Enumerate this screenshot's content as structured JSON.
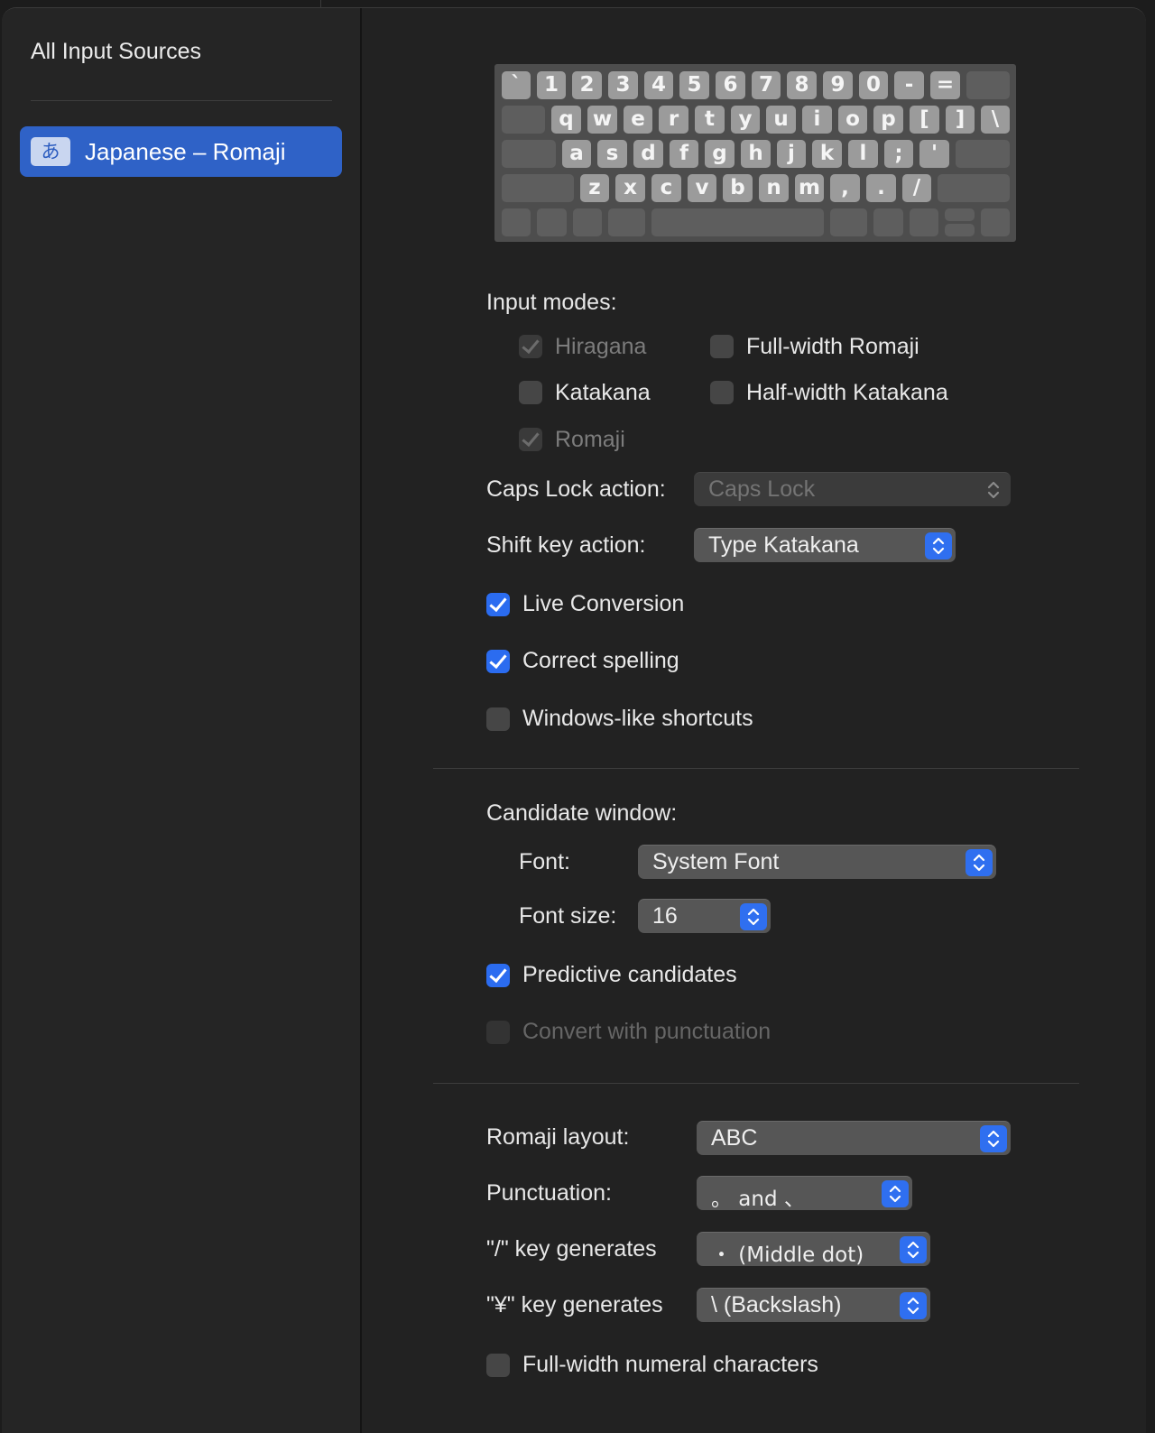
{
  "sidebar": {
    "title": "All Input Sources",
    "items": [
      {
        "badge": "あ",
        "label": "Japanese – Romaji"
      }
    ]
  },
  "keyboard": {
    "row1": [
      "`",
      "1",
      "2",
      "3",
      "4",
      "5",
      "6",
      "7",
      "8",
      "9",
      "0",
      "-",
      "="
    ],
    "row2": [
      "q",
      "w",
      "e",
      "r",
      "t",
      "y",
      "u",
      "i",
      "o",
      "p",
      "[",
      "]",
      "\\"
    ],
    "row3": [
      "a",
      "s",
      "d",
      "f",
      "g",
      "h",
      "j",
      "k",
      "l",
      ";",
      "'"
    ],
    "row4": [
      "z",
      "x",
      "c",
      "v",
      "b",
      "n",
      "m",
      ",",
      ".",
      "/"
    ]
  },
  "input_modes": {
    "label": "Input modes:",
    "hiragana": {
      "label": "Hiragana",
      "checked": true,
      "enabled": false
    },
    "katakana": {
      "label": "Katakana",
      "checked": false,
      "enabled": true
    },
    "romaji": {
      "label": "Romaji",
      "checked": true,
      "enabled": false
    },
    "fullwidth_romaji": {
      "label": "Full-width Romaji",
      "checked": false,
      "enabled": true
    },
    "halfwidth_katakana": {
      "label": "Half-width Katakana",
      "checked": false,
      "enabled": true
    }
  },
  "caps_lock": {
    "label": "Caps Lock action:",
    "value": "Caps Lock",
    "enabled": false
  },
  "shift_key": {
    "label": "Shift key action:",
    "value": "Type Katakana"
  },
  "options": {
    "live_conversion": {
      "label": "Live Conversion",
      "checked": true
    },
    "correct_spelling": {
      "label": "Correct spelling",
      "checked": true
    },
    "windows_shortcuts": {
      "label": "Windows-like shortcuts",
      "checked": false
    }
  },
  "candidate": {
    "label": "Candidate window:",
    "font_label": "Font:",
    "font_value": "System Font",
    "size_label": "Font size:",
    "size_value": "16",
    "predictive": {
      "label": "Predictive candidates",
      "checked": true
    },
    "convert_punct": {
      "label": "Convert with punctuation",
      "checked": false,
      "enabled": false
    }
  },
  "layout": {
    "romaji_label": "Romaji layout:",
    "romaji_value": "ABC",
    "punct_label": "Punctuation:",
    "punct_value": "。 and 、",
    "slash_label": "\"/\" key generates",
    "slash_value": "・ (Middle dot)",
    "yen_label": "\"¥\" key generates",
    "yen_value": "\\ (Backslash)",
    "fullwidth_numerals": {
      "label": "Full-width numeral characters",
      "checked": false
    }
  },
  "colors": {
    "accent": "#2f6ff0",
    "selection": "#2f62c7",
    "background": "#222222"
  }
}
